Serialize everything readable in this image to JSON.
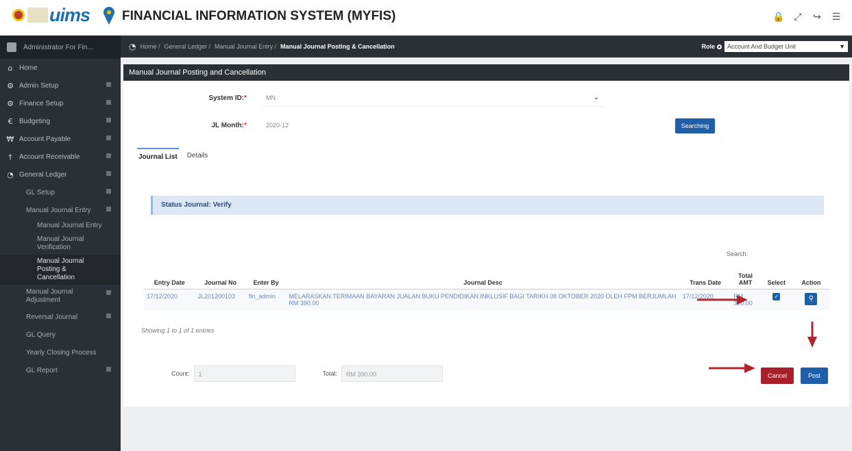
{
  "header": {
    "logo_text": "uims",
    "app_title": "FINANCIAL INFORMATION SYSTEM (MYFIS)",
    "icons": [
      "lock-icon",
      "expand-icon",
      "logout-icon",
      "menu-icon"
    ]
  },
  "sidebar": {
    "user": "Administrator For Fin...",
    "items": [
      {
        "label": "Home",
        "icon": "home-icon"
      },
      {
        "label": "Admin Setup",
        "icon": "cogs-icon"
      },
      {
        "label": "Finance Setup",
        "icon": "gear-icon"
      },
      {
        "label": "Budgeting",
        "icon": "euro-icon"
      },
      {
        "label": "Account Payable",
        "icon": "won-icon"
      },
      {
        "label": "Account Receivable",
        "icon": "dagger-icon"
      },
      {
        "label": "General Ledger",
        "icon": "dashboard-icon"
      }
    ],
    "gl_items": [
      {
        "label": "GL Setup"
      },
      {
        "label": "Manual Journal Entry"
      }
    ],
    "mje_items": [
      {
        "label": "Manual Journal Entry"
      },
      {
        "label": "Manual Journal Verification"
      },
      {
        "label": "Manual Journal Posting & Cancellation"
      }
    ],
    "gl_items_after": [
      {
        "label": "Manual Journal Adjustment"
      },
      {
        "label": "Reversal Journal"
      },
      {
        "label": "GL Query"
      },
      {
        "label": "Yearly Closing Process"
      },
      {
        "label": "GL Report"
      }
    ]
  },
  "breadcrumb": {
    "items": [
      "Home /",
      "General Ledger /",
      "Manual Journal Entry /"
    ],
    "current": "Manual Journal Posting & Cancellation",
    "role_label": "Role",
    "role_value": "Account And Budget Unit"
  },
  "panel": {
    "title": "Manual Journal Posting and Cancellation",
    "system_id_label": "System ID:",
    "system_id_value": "MN",
    "jl_month_label": "JL Month:",
    "jl_month_value": "2020-12",
    "search_button": "Searching",
    "tabs": [
      "Journal List",
      "Details"
    ],
    "status_text": "Status Journal: Verify",
    "search_label": "Search:"
  },
  "table": {
    "headers": [
      "Entry Date",
      "Journal No",
      "Enter By",
      "Journal Desc",
      "Trans Date",
      "Total AMT",
      "Select",
      "Action"
    ],
    "rows": [
      {
        "entry_date": "17/12/2020",
        "journal_no": "JL201200103",
        "enter_by": "fin_admin",
        "desc": "MELARASKAN TERIMAAN BAYARAN JUALAN BUKU PENDIDIKAN INKLUSIF BAGI TARIKH 08 OKTOBER 2020 OLEH FPM BERJUMLAH RM 390.00",
        "trans_date": "17/12/2020",
        "total_amt": "RM 390.00"
      }
    ],
    "entries_info": "Showing 1 to 1 of 1 entries"
  },
  "footer": {
    "count_label": "Count:",
    "count_value": "1",
    "total_label": "Total:",
    "total_value": "RM 390.00",
    "cancel_button": "Cancel",
    "post_button": "Post"
  },
  "colors": {
    "sidebar_bg": "#2b3036",
    "primary_button": "#1e5fa8",
    "cancel_button": "#a8202c",
    "annotation_arrow": "#b0262c"
  }
}
